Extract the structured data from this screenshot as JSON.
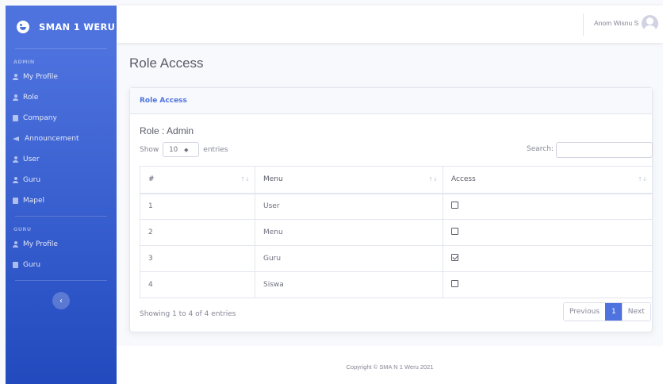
{
  "sidebar": {
    "brand": "SMAN 1 WERU",
    "sections": [
      {
        "heading": "ADMIN",
        "items": [
          {
            "label": "My Profile",
            "icon": "user-icon"
          },
          {
            "label": "Role",
            "icon": "user-icon"
          },
          {
            "label": "Company",
            "icon": "building-icon"
          },
          {
            "label": "Announcement",
            "icon": "megaphone-icon"
          },
          {
            "label": "User",
            "icon": "user-icon"
          },
          {
            "label": "Guru",
            "icon": "user-icon"
          },
          {
            "label": "Mapel",
            "icon": "table-icon"
          }
        ]
      },
      {
        "heading": "GURU",
        "items": [
          {
            "label": "My Profile",
            "icon": "user-icon"
          },
          {
            "label": "Guru",
            "icon": "table-icon"
          }
        ]
      }
    ],
    "toggle": "‹"
  },
  "topbar": {
    "user_name": "Anom Wisnu S"
  },
  "main": {
    "page_title": "Role Access",
    "card_title": "Role Access",
    "role_label": "Role : Admin",
    "show_label": "Show",
    "page_length": "10",
    "entries_label": "entries",
    "search_label": "Search:",
    "search_value": "",
    "table": {
      "headers": [
        "#",
        "Menu",
        "Access"
      ],
      "rows": [
        {
          "num": "1",
          "menu": "User",
          "access": false
        },
        {
          "num": "2",
          "menu": "Menu",
          "access": false
        },
        {
          "num": "3",
          "menu": "Guru",
          "access": true
        },
        {
          "num": "4",
          "menu": "Siswa",
          "access": false
        }
      ]
    },
    "info": "Showing 1 to 4 of 4 entries",
    "pagination": {
      "previous": "Previous",
      "current": "1",
      "next": "Next"
    }
  },
  "footer": {
    "copyright": "Copyright © SMA N 1 Weru 2021"
  },
  "colors": {
    "primary": "#4e73df",
    "sidebar_end": "#224abe",
    "page_bg": "#f8f9fc",
    "text": "#858796"
  }
}
